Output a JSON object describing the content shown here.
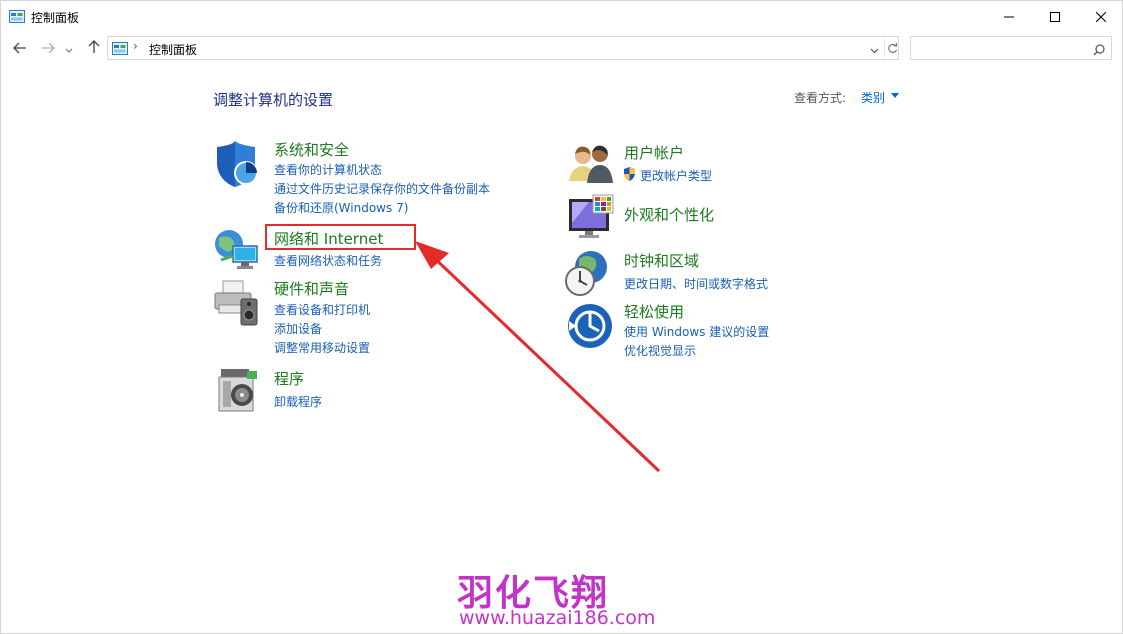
{
  "window": {
    "title": "控制面板",
    "minimize_icon": "minimize-icon",
    "maximize_icon": "maximize-icon",
    "close_icon": "close-icon"
  },
  "nav": {
    "address_text": "控制面板",
    "separator": "›",
    "search_placeholder": ""
  },
  "main": {
    "heading": "调整计算机的设置",
    "view_by_label": "查看方式:",
    "view_by_value": "类别"
  },
  "categories": [
    {
      "title": "系统和安全",
      "icon": "shield-icon",
      "links": [
        "查看你的计算机状态",
        "通过文件历史记录保存你的文件备份副本",
        "备份和还原(Windows 7)"
      ]
    },
    {
      "title": "网络和 Internet",
      "icon": "network-globe-icon",
      "links": [
        "查看网络状态和任务"
      ]
    },
    {
      "title": "硬件和声音",
      "icon": "printer-icon",
      "links": [
        "查看设备和打印机",
        "添加设备",
        "调整常用移动设置"
      ]
    },
    {
      "title": "程序",
      "icon": "programs-disc-icon",
      "links": [
        "卸载程序"
      ]
    },
    {
      "title": "用户帐户",
      "icon": "users-icon",
      "links": [
        "更改帐户类型"
      ]
    },
    {
      "title": "外观和个性化",
      "icon": "monitor-palette-icon",
      "links": []
    },
    {
      "title": "时钟和区域",
      "icon": "clock-globe-icon",
      "links": [
        "更改日期、时间或数字格式"
      ]
    },
    {
      "title": "轻松使用",
      "icon": "ease-of-access-icon",
      "links": [
        "使用 Windows 建议的设置",
        "优化视觉显示"
      ]
    }
  ],
  "watermark": {
    "brand": "羽化飞翔",
    "url": "www.huazai186.com"
  },
  "colors": {
    "category_title": "#1e7a1e",
    "link": "#1a5fb4",
    "heading": "#1e3287",
    "annotation": "#e52a2a",
    "watermark": "#c433c9"
  }
}
